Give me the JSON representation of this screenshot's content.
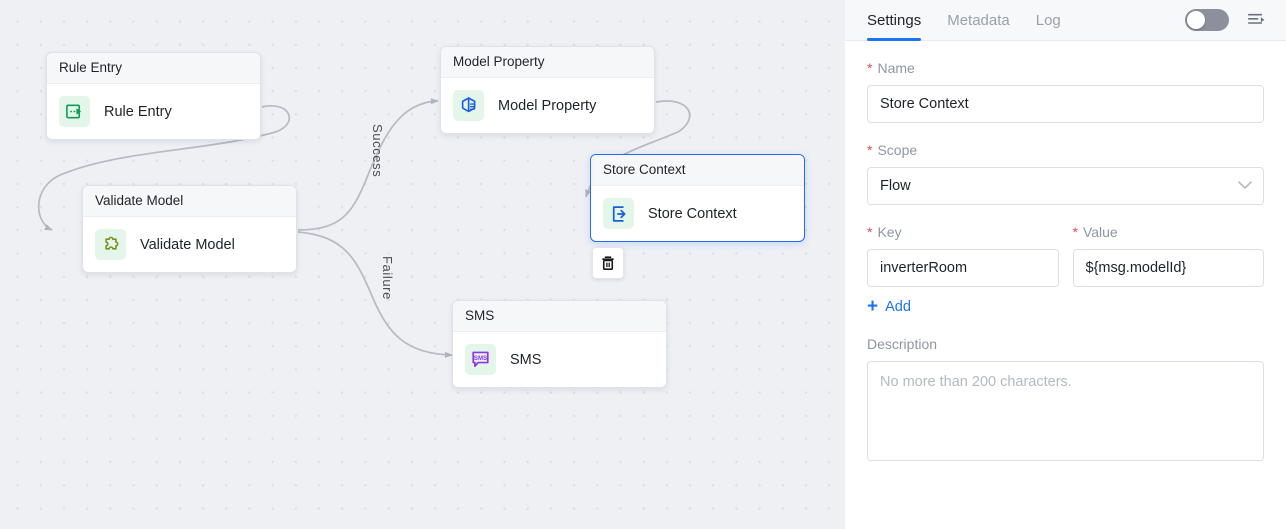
{
  "canvas": {
    "nodes": [
      {
        "id": "rule-entry",
        "header": "Rule Entry",
        "label": "Rule Entry",
        "icon": "rule-entry-icon"
      },
      {
        "id": "validate-model",
        "header": "Validate Model",
        "label": "Validate Model",
        "icon": "puzzle-icon"
      },
      {
        "id": "model-property",
        "header": "Model Property",
        "label": "Model Property",
        "icon": "model-property-icon"
      },
      {
        "id": "store-context",
        "header": "Store Context",
        "label": "Store Context",
        "icon": "store-context-icon"
      },
      {
        "id": "sms",
        "header": "SMS",
        "label": "SMS",
        "icon": "sms-icon"
      }
    ],
    "edge_labels": [
      "Success",
      "Failure"
    ],
    "delete_tooltip": "Delete",
    "colors": {
      "background": "#eef0f4",
      "dot": "#dcdfe6",
      "edge": "#b6bac4",
      "selected_border": "#246bfd"
    }
  },
  "panel": {
    "tabs": [
      {
        "label": "Settings",
        "active": true
      },
      {
        "label": "Metadata",
        "active": false
      },
      {
        "label": "Log",
        "active": false
      }
    ],
    "toggle_on": false,
    "menu_icon": "panel-collapse-icon",
    "fields": {
      "name_label": "Name",
      "name_value": "Store Context",
      "scope_label": "Scope",
      "scope_value": "Flow",
      "key_label": "Key",
      "key_value": "inverterRoom",
      "value_label": "Value",
      "value_value": "${msg.modelId}",
      "add_label": "Add",
      "description_label": "Description",
      "description_value": "",
      "description_placeholder": "No more than 200 characters."
    },
    "accent": "#1a73f0",
    "required_color": "#e34d4d"
  }
}
